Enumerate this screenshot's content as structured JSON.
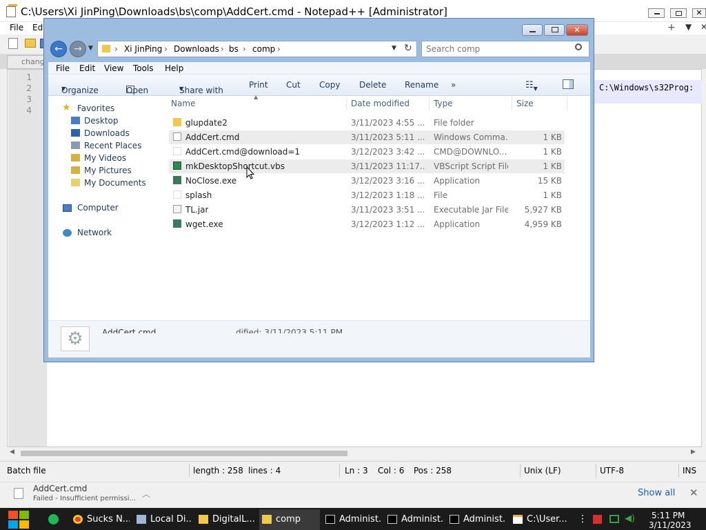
{
  "notepad": {
    "title": "C:\\Users\\Xi JinPing\\Downloads\\bs\\comp\\AddCert.cmd - Notepad++ [Administrator]",
    "menu": [
      "File",
      "Edi"
    ],
    "tab_label": "change",
    "line_numbers": [
      "1",
      "2",
      "3",
      "4"
    ],
    "code_visible": "C:\\Windows\\s32Prog:",
    "status": {
      "file_type": "Batch file",
      "length": "length : 258",
      "lines": "lines : 4",
      "ln": "Ln : 3",
      "col": "Col : 6",
      "pos": "Pos : 258",
      "eol": "Unix (LF)",
      "encoding": "UTF-8",
      "mode": "INS"
    }
  },
  "explorer": {
    "breadcrumb": [
      "Xi JinPing",
      "Downloads",
      "bs",
      "comp"
    ],
    "search_placeholder": "Search comp",
    "menu": [
      "File",
      "Edit",
      "View",
      "Tools",
      "Help"
    ],
    "toolbar": {
      "organize": "Organize",
      "open": "Open",
      "share": "Share with",
      "print": "Print",
      "cut": "Cut",
      "copy": "Copy",
      "delete": "Delete",
      "rename": "Rename",
      "more": "»"
    },
    "nav": {
      "favorites": "Favorites",
      "items": [
        "Desktop",
        "Downloads",
        "Recent Places",
        "My Videos",
        "My Pictures",
        "My Documents"
      ],
      "computer": "Computer",
      "network": "Network"
    },
    "columns": {
      "name": "Name",
      "date": "Date modified",
      "type": "Type",
      "size": "Size"
    },
    "files": [
      {
        "name": "glupdate2",
        "date": "3/11/2023 4:55 ...",
        "type": "File folder",
        "size": ""
      },
      {
        "name": "AddCert.cmd",
        "date": "3/11/2023 5:11 ...",
        "type": "Windows Comma...",
        "size": "1 KB"
      },
      {
        "name": "AddCert.cmd@download=1",
        "date": "3/12/2023 3:42 ...",
        "type": "CMD@DOWNLO...",
        "size": "1 KB"
      },
      {
        "name": "mkDesktopShortcut.vbs",
        "date": "3/11/2023 11:17...",
        "type": "VBScript Script File",
        "size": "1 KB"
      },
      {
        "name": "NoClose.exe",
        "date": "3/12/2023 3:16 ...",
        "type": "Application",
        "size": "15 KB"
      },
      {
        "name": "splash",
        "date": "3/12/2023 1:18 ...",
        "type": "File",
        "size": "1 KB"
      },
      {
        "name": "TL.jar",
        "date": "3/11/2023 3:51 ...",
        "type": "Executable Jar File",
        "size": "5,927 KB"
      },
      {
        "name": "wget.exe",
        "date": "3/12/2023 1:12 ...",
        "type": "Application",
        "size": "4,959 KB"
      }
    ],
    "details": {
      "name": "AddCert.cmd",
      "modified": "dified: 3/11/2023 5:11 PM"
    }
  },
  "notification": {
    "title": "AddCert.cmd",
    "message": "Failed - Insufficient permissi...",
    "show_all": "Show all"
  },
  "taskbar": {
    "items": [
      "Sucks N...",
      "Local Di...",
      "DigitalL...",
      "comp",
      "Administ...",
      "Administ...",
      "Administ...",
      "C:\\User..."
    ],
    "time": "5:11 PM",
    "date": "3/11/2023"
  },
  "colors": {
    "accent": "#3c78c8",
    "taskbar": "#1b1b1b",
    "explorer_frame": "#9cbde0"
  }
}
